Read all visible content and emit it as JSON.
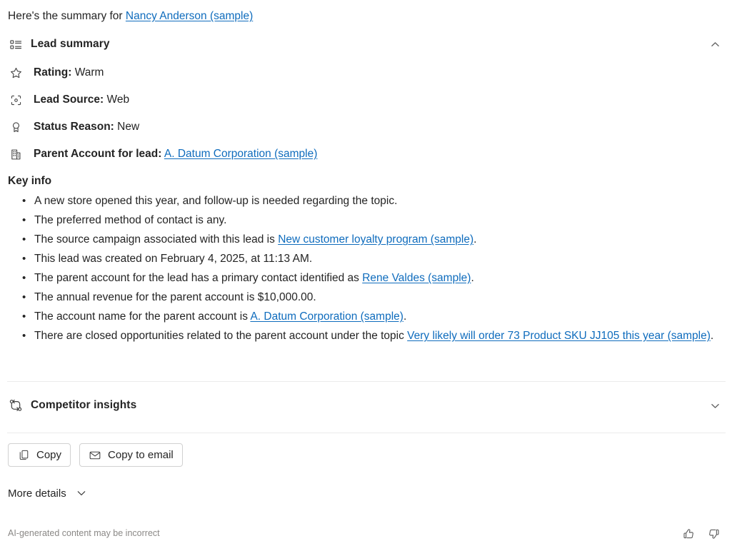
{
  "intro": {
    "prefix": "Here's the summary for ",
    "link_text": "Nancy Anderson (sample)"
  },
  "lead_summary": {
    "icon": "list-icon",
    "title": "Lead summary",
    "chevron": "chevron-up-icon",
    "fields": [
      {
        "icon": "star-icon",
        "label": "Rating:",
        "value": "Warm",
        "link": false
      },
      {
        "icon": "target-icon",
        "label": "Lead Source:",
        "value": "Web",
        "link": false
      },
      {
        "icon": "ribbon-icon",
        "label": "Status Reason:",
        "value": "New",
        "link": false
      },
      {
        "icon": "building-icon",
        "label": "Parent Account for lead:",
        "value": "A. Datum Corporation (sample)",
        "link": true
      }
    ]
  },
  "key_info": {
    "title": "Key info",
    "items": [
      {
        "parts": [
          {
            "t": "A new store opened this year, and follow-up is needed regarding the topic.",
            "link": false
          }
        ]
      },
      {
        "parts": [
          {
            "t": "The preferred method of contact is any.",
            "link": false
          }
        ]
      },
      {
        "parts": [
          {
            "t": "The source campaign associated with this lead is ",
            "link": false
          },
          {
            "t": "New customer loyalty program (sample)",
            "link": true
          },
          {
            "t": ".",
            "link": false
          }
        ]
      },
      {
        "parts": [
          {
            "t": "This lead was created on February 4, 2025, at 11:13 AM.",
            "link": false
          }
        ]
      },
      {
        "parts": [
          {
            "t": "The parent account for the lead has a primary contact identified as ",
            "link": false
          },
          {
            "t": "Rene Valdes (sample)",
            "link": true
          },
          {
            "t": ".",
            "link": false
          }
        ]
      },
      {
        "parts": [
          {
            "t": "The annual revenue for the parent account is $10,000.00.",
            "link": false
          }
        ]
      },
      {
        "parts": [
          {
            "t": "The account name for the parent account is ",
            "link": false
          },
          {
            "t": "A. Datum Corporation (sample)",
            "link": true
          },
          {
            "t": ".",
            "link": false
          }
        ]
      },
      {
        "parts": [
          {
            "t": "There are closed opportunities related to the parent account under the topic ",
            "link": false
          },
          {
            "t": "Very likely will order 73 Product SKU JJ105 this year (sample)",
            "link": true
          },
          {
            "t": ".",
            "link": false
          }
        ]
      }
    ]
  },
  "competitor_insights": {
    "icon": "branch-swap-icon",
    "title": "Competitor insights",
    "chevron": "chevron-down-icon"
  },
  "actions": {
    "copy": {
      "icon": "copy-icon",
      "label": "Copy"
    },
    "copy_to_email": {
      "icon": "mail-icon",
      "label": "Copy to email"
    }
  },
  "more_details": {
    "label": "More details",
    "chevron": "chevron-down-icon"
  },
  "footer": {
    "disclaimer": "AI-generated content may be incorrect",
    "thumbs_up": "thumbs-up-icon",
    "thumbs_down": "thumbs-down-icon"
  },
  "colors": {
    "link": "#0f6cbd",
    "text": "#242424",
    "muted": "#8a8886",
    "divider": "#ebebeb",
    "border": "#d1d1d1"
  }
}
